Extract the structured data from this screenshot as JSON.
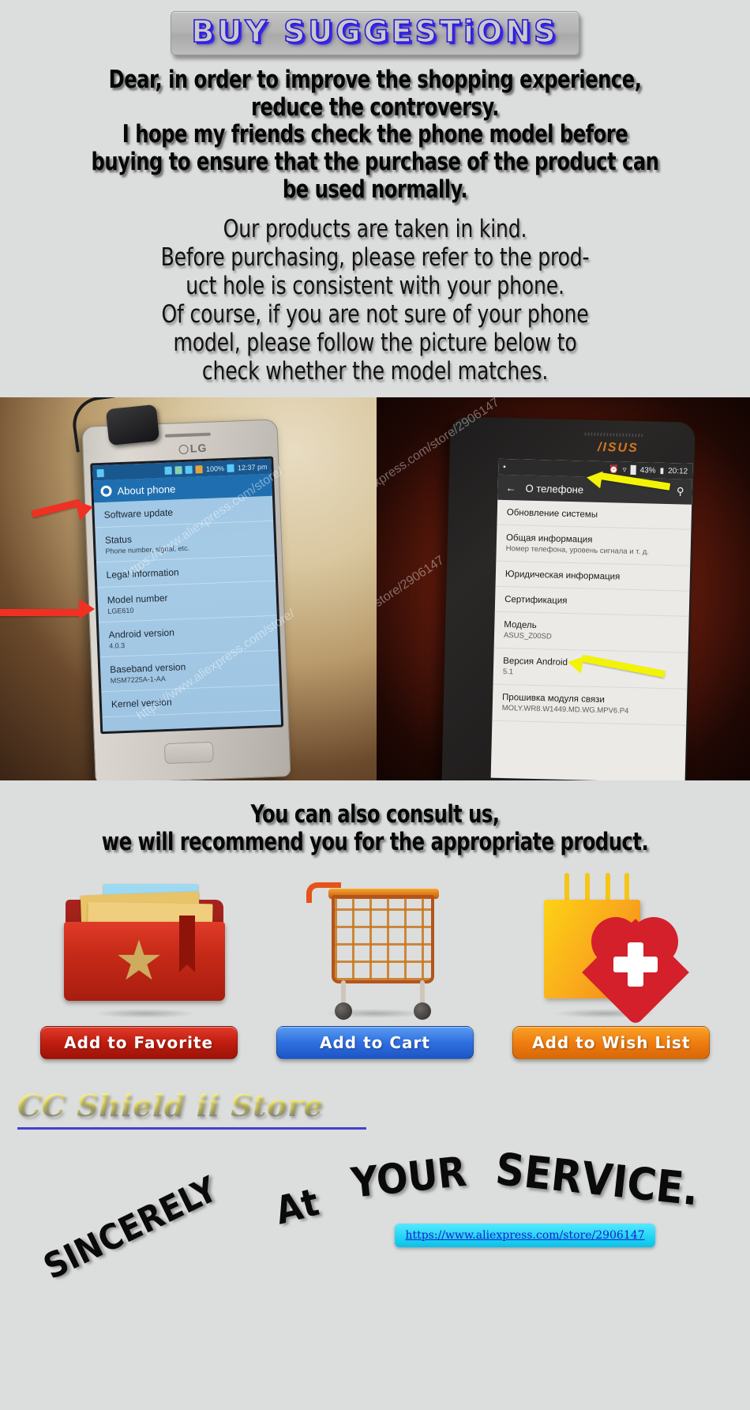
{
  "header": {
    "banner_title": "BUY SUGGESTiONS"
  },
  "intro": {
    "bold_lines": [
      "Dear, in order to improve the shopping experience,",
      "reduce the controversy.",
      "I hope my friends check the phone model before",
      "buying to ensure that the purchase of the product can",
      "be used normally."
    ],
    "light_lines": [
      "Our products are taken in kind.",
      "Before purchasing, please refer to the prod-",
      "uct hole is consistent with your phone.",
      "Of course, if you are not sure of your phone",
      "model, please follow the picture below to",
      "check whether the model matches."
    ]
  },
  "photo_left": {
    "brand_logo": "LG",
    "status_bar": {
      "battery_percent": "100%",
      "time": "12:37 pm"
    },
    "screen_title": "About phone",
    "rows": [
      {
        "title": "Software update",
        "subtitle": ""
      },
      {
        "title": "Status",
        "subtitle": "Phone number, signal, etc."
      },
      {
        "title": "Legal information",
        "subtitle": ""
      },
      {
        "title": "Model number",
        "subtitle": "LGE610"
      },
      {
        "title": "Android version",
        "subtitle": "4.0.3"
      },
      {
        "title": "Baseband version",
        "subtitle": "MSM7225A-1-AA"
      },
      {
        "title": "Kernel version",
        "subtitle": ""
      }
    ],
    "watermark": "https://www.aliexpress.com/store/"
  },
  "photo_right": {
    "brand_logo": "/ISUS",
    "status_bar": {
      "battery_percent": "43%",
      "time": "20:12"
    },
    "screen_title": "О телефоне",
    "rows": [
      {
        "title": "Обновление системы",
        "subtitle": ""
      },
      {
        "title": "Общая информация",
        "subtitle": "Номер телефона, уровень сигнала и т. д."
      },
      {
        "title": "Юридическая информация",
        "subtitle": ""
      },
      {
        "title": "Сертификация",
        "subtitle": ""
      },
      {
        "title": "Модель",
        "subtitle": "ASUS_Z00SD"
      },
      {
        "title": "Версия Android",
        "subtitle": "5.1"
      },
      {
        "title": "Прошивка модуля связи",
        "subtitle": "MOLY.WR8.W1449.MD.WG.MPV6.P4"
      }
    ],
    "watermark": "https://www.aliexpress.com/store/2906147"
  },
  "consult": {
    "lines": [
      "You can also consult us,",
      "we will recommend you for the appropriate product."
    ]
  },
  "actions": [
    {
      "label": "Add to Favorite",
      "icon": "folder-star-icon",
      "color": "#c01d10"
    },
    {
      "label": "Add to Cart",
      "icon": "shopping-cart-icon",
      "color": "#2f6fe0"
    },
    {
      "label": "Add to Wish List",
      "icon": "gift-bag-heart-icon",
      "color": "#ef7d10"
    }
  ],
  "footer": {
    "store_name": "CC Shield ii Store",
    "tagline_words": [
      "SINCERELY",
      "At",
      "YOUR",
      "SERVICE."
    ],
    "store_url": "https://www.aliexpress.com/store/2906147"
  }
}
